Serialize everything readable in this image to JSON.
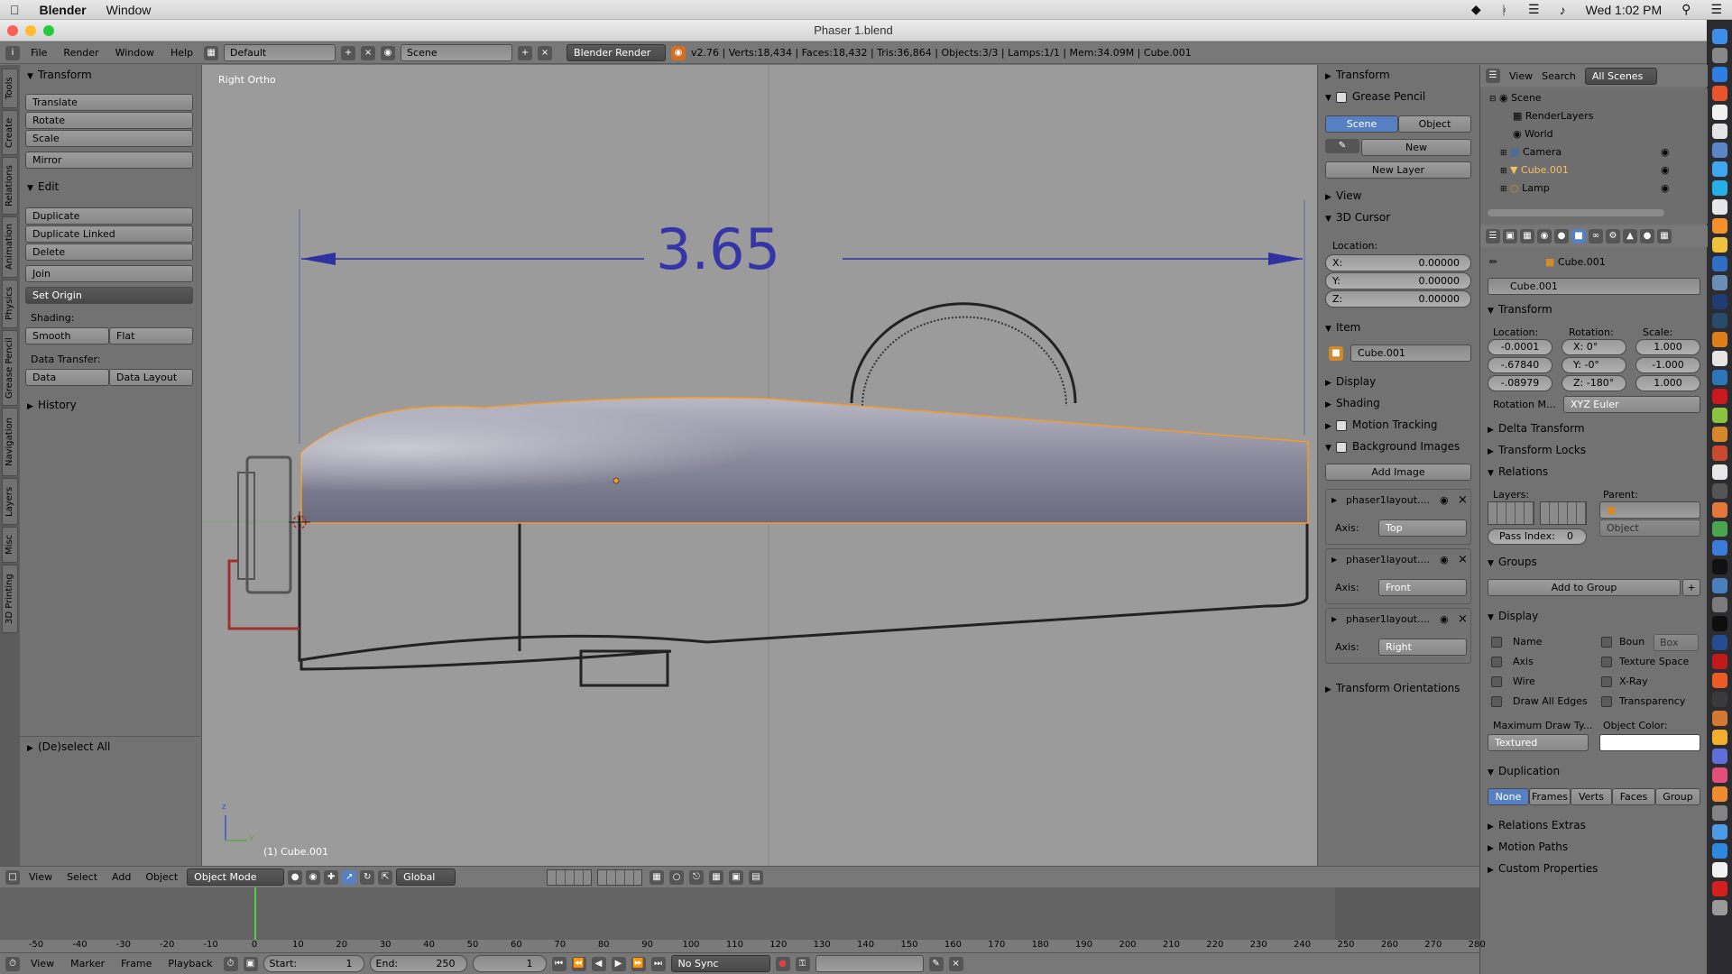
{
  "macbar": {
    "app": "Blender",
    "window_menu": "Window",
    "clock": "Wed 1:02 PM"
  },
  "window": {
    "title": "Phaser 1.blend"
  },
  "info_header": {
    "menus": [
      "File",
      "Render",
      "Window",
      "Help"
    ],
    "layout": "Default",
    "scene": "Scene",
    "engine": "Blender Render",
    "stats": "v2.76 | Verts:18,434 | Faces:18,432 | Tris:36,864 | Objects:3/3 | Lamps:1/1 | Mem:34.09M | Cube.001"
  },
  "left_tabs": [
    "Tools",
    "Create",
    "Relations",
    "Animation",
    "Physics",
    "Grease Pencil",
    "Navigation",
    "Layers",
    "Misc",
    "3D Printing"
  ],
  "toolshelf": {
    "transform_header": "Transform",
    "translate": "Translate",
    "rotate": "Rotate",
    "scale": "Scale",
    "mirror": "Mirror",
    "edit_header": "Edit",
    "duplicate": "Duplicate",
    "duplicate_linked": "Duplicate Linked",
    "delete": "Delete",
    "join": "Join",
    "set_origin": "Set Origin",
    "shading_label": "Shading:",
    "smooth": "Smooth",
    "flat": "Flat",
    "data_transfer_label": "Data Transfer:",
    "data": "Data",
    "data_layout": "Data Layout",
    "history_header": "History",
    "operator_header": "(De)select All"
  },
  "viewport": {
    "view_label": "Right Ortho",
    "dimension": "3.65",
    "object_label": "(1) Cube.001",
    "axis_z": "z",
    "axis_y": "y"
  },
  "npanel": {
    "transform": "Transform",
    "grease_pencil": "Grease Pencil",
    "gp_scene": "Scene",
    "gp_object": "Object",
    "gp_new": "New",
    "gp_new_layer": "New Layer",
    "view": "View",
    "cursor": "3D Cursor",
    "location_label": "Location:",
    "cx_label": "X:",
    "cx": "0.00000",
    "cy_label": "Y:",
    "cy": "0.00000",
    "cz_label": "Z:",
    "cz": "0.00000",
    "item": "Item",
    "item_name": "Cube.001",
    "display": "Display",
    "shading": "Shading",
    "motion_tracking": "Motion Tracking",
    "background_images": "Background Images",
    "add_image": "Add Image",
    "bg_images": [
      {
        "name": "phaser1layout....",
        "axis_label": "Axis:",
        "axis": "Top"
      },
      {
        "name": "phaser1layout....",
        "axis_label": "Axis:",
        "axis": "Front"
      },
      {
        "name": "phaser1layout....",
        "axis_label": "Axis:",
        "axis": "Right"
      }
    ],
    "transform_orientations": "Transform Orientations"
  },
  "outliner": {
    "view": "View",
    "search": "Search",
    "all_scenes": "All Scenes",
    "items": [
      "Scene",
      "RenderLayers",
      "World",
      "Camera",
      "Cube.001",
      "Lamp"
    ]
  },
  "props": {
    "breadcrumb": "Cube.001",
    "object_name": "Cube.001",
    "transform": "Transform",
    "location_label": "Location:",
    "rotation_label": "Rotation:",
    "scale_label": "Scale:",
    "loc": [
      "-0.0001",
      "-.67840",
      "-.08979"
    ],
    "rot_labels": [
      "X:",
      "Y:",
      "Z:"
    ],
    "rot": [
      "0°",
      "-0°",
      "-180°"
    ],
    "scale": [
      "1.000",
      "-1.000",
      "1.000"
    ],
    "rotation_mode_label": "Rotation M...",
    "rotation_mode": "XYZ Euler",
    "delta_transform": "Delta Transform",
    "transform_locks": "Transform Locks",
    "relations": "Relations",
    "layers_label": "Layers:",
    "parent_label": "Parent:",
    "parent_type": "Object",
    "pass_index_label": "Pass Index:",
    "pass_index": "0",
    "groups": "Groups",
    "add_to_group": "Add to Group",
    "display": "Display",
    "display_left": [
      "Name",
      "Axis",
      "Wire",
      "Draw All Edges"
    ],
    "display_right": [
      "Boun",
      "Texture Space",
      "X-Ray",
      "Transparency"
    ],
    "bounds_type": "Box",
    "max_draw_label": "Maximum Draw Ty...",
    "max_draw": "Textured",
    "object_color_label": "Object Color:",
    "duplication": "Duplication",
    "dup_options": [
      "None",
      "Frames",
      "Verts",
      "Faces",
      "Group"
    ],
    "relations_extras": "Relations Extras",
    "motion_paths": "Motion Paths",
    "custom_properties": "Custom Properties"
  },
  "view3d_header": {
    "menus": [
      "View",
      "Select",
      "Add",
      "Object"
    ],
    "mode": "Object Mode",
    "orientation": "Global"
  },
  "timeline": {
    "ticks": [
      "-50",
      "-40",
      "-30",
      "-20",
      "-10",
      "0",
      "10",
      "20",
      "30",
      "40",
      "50",
      "60",
      "70",
      "80",
      "90",
      "100",
      "110",
      "120",
      "130",
      "140",
      "150",
      "160",
      "170",
      "180",
      "190",
      "200",
      "210",
      "220",
      "230",
      "240",
      "250",
      "260",
      "270",
      "280"
    ],
    "current": "0"
  },
  "timeline_header": {
    "menus": [
      "View",
      "Marker",
      "Frame",
      "Playback"
    ],
    "start_label": "Start:",
    "start": "1",
    "end_label": "End:",
    "end": "250",
    "frame": "1",
    "sync": "No Sync"
  }
}
